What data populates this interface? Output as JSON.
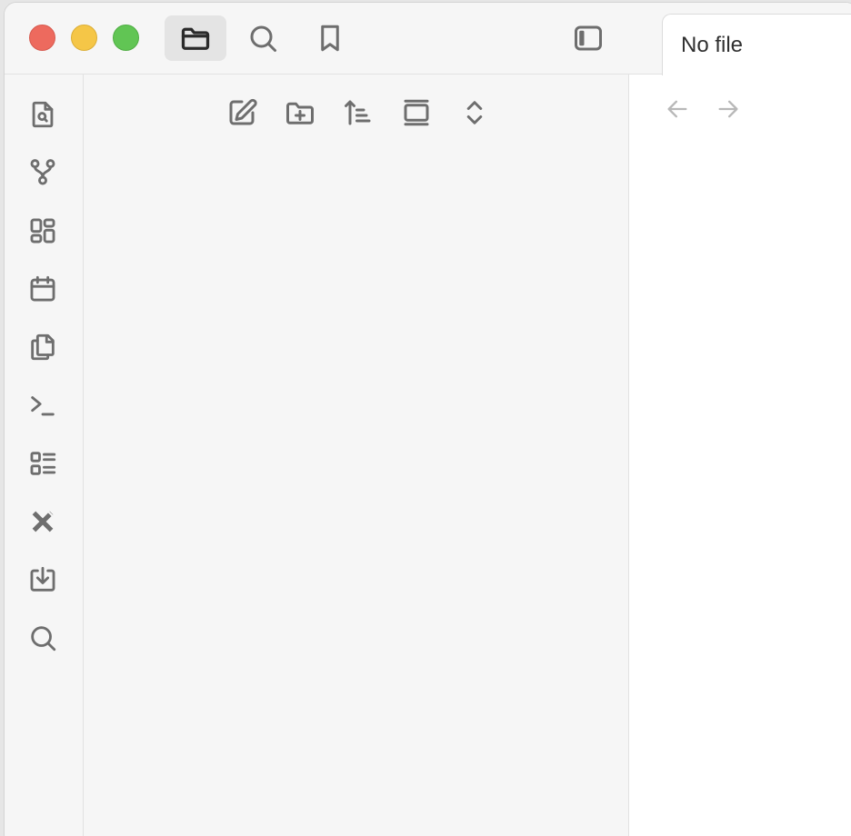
{
  "window": {
    "traffic_lights": {
      "close": "#ed6a5e",
      "minimize": "#f5c647",
      "maximize": "#61c554"
    }
  },
  "titlebar": {
    "buttons": [
      {
        "name": "files-icon",
        "active": true
      },
      {
        "name": "search-icon",
        "active": false
      },
      {
        "name": "bookmark-icon",
        "active": false
      },
      {
        "name": "sidebar-toggle-icon",
        "active": false
      }
    ]
  },
  "ribbon": {
    "items": [
      "file-search-icon",
      "graph-icon",
      "canvas-icon",
      "calendar-icon",
      "copy-icon",
      "command-palette-icon",
      "outline-icon",
      "plugin-tools-icon",
      "import-icon",
      "search-icon"
    ]
  },
  "explorer": {
    "nav_buttons": [
      "new-note-icon",
      "new-folder-icon",
      "sort-icon",
      "collapse-view-icon",
      "expand-collapse-icon"
    ]
  },
  "main": {
    "tab": {
      "title": "No file"
    },
    "nav": {
      "back": "arrow-left-icon",
      "forward": "arrow-right-icon"
    }
  }
}
